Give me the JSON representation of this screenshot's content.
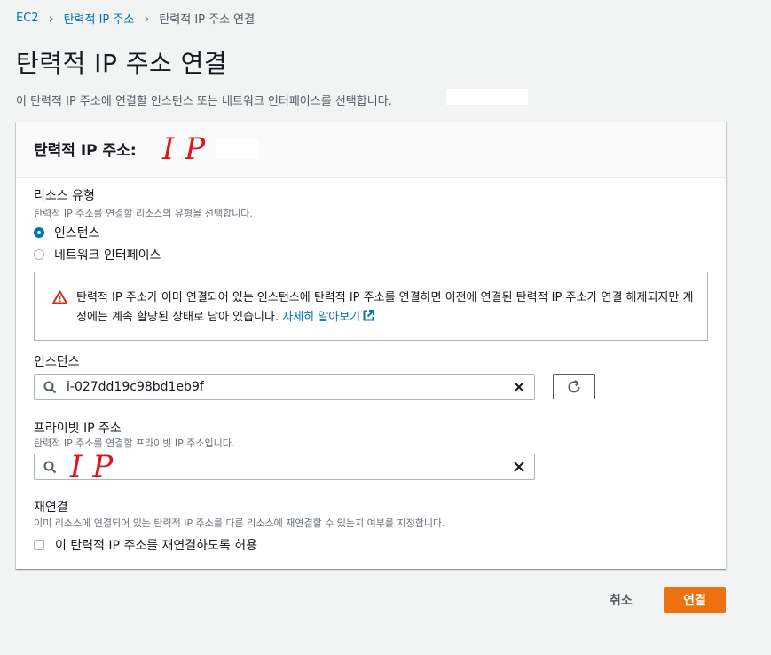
{
  "breadcrumb": {
    "root": "EC2",
    "parent": "탄력적 IP 주소",
    "current": "탄력적 IP 주소 연결"
  },
  "page": {
    "title": "탄력적 IP 주소 연결",
    "description": "이 탄력적 IP 주소에 연결할 인스턴스 또는 네트워크 인터페이스를 선택합니다."
  },
  "panel": {
    "header": "탄력적 IP 주소:",
    "header_handwritten": "IP",
    "resource_type": {
      "label": "리소스 유형",
      "description": "탄력적 IP 주소를 연결할 리소스의 유형을 선택합니다.",
      "options": [
        "인스턴스",
        "네트워크 인터페이스"
      ],
      "selected": "인스턴스"
    },
    "alert": {
      "message": "탄력적 IP 주소가 이미 연결되어 있는 인스턴스에 탄력적 IP 주소를 연결하면 이전에 연결된 탄력적 IP 주소가 연결 해제되지만 계정에는 계속 할당된 상태로 남아 있습니다.",
      "link": "자세히 알아보기"
    },
    "instance": {
      "label": "인스턴스",
      "value": "i-027dd19c98bd1eb9f"
    },
    "private_ip": {
      "label": "프라이빗 IP 주소",
      "description": "탄력적 IP 주소를 연결할 프라이빗 IP 주소입니다.",
      "handwritten": "IP"
    },
    "reassociate": {
      "label": "재연결",
      "description": "이미 리소스에 연결되어 있는 탄력적 IP 주소를 다른 리소스에 재연결할 수 있는지 여부를 지정합니다.",
      "checkbox_label": "이 탄력적 IP 주소를 재연결하도록 허용",
      "checked": false
    }
  },
  "footer": {
    "cancel": "취소",
    "connect": "연결"
  },
  "colors": {
    "link": "#0073bb",
    "primary": "#ec7211",
    "warning": "#d13212",
    "handwriting": "#e0141e"
  }
}
